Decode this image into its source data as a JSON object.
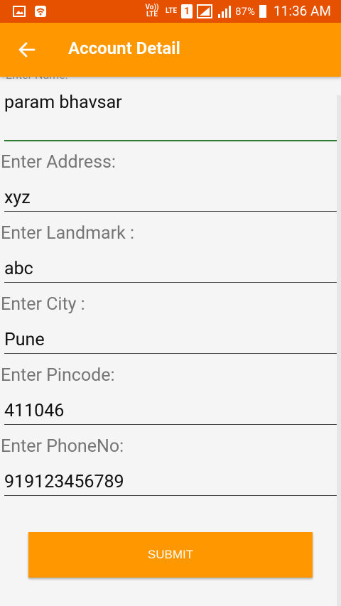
{
  "status_bar": {
    "network": "Vo)) LTE",
    "lte": "LTE",
    "sim": "1",
    "battery_percent": "87%",
    "time": "11:36 AM"
  },
  "app_bar": {
    "title": "Account Detail",
    "back_icon": "arrow-back-icon"
  },
  "form": {
    "name_label_partial": "Enter Name:",
    "name_value": "param bhavsar",
    "address_label": "Enter Address:",
    "address_value": "xyz",
    "landmark_label": "Enter Landmark :",
    "landmark_value": "abc",
    "city_label": "Enter City :",
    "city_value": "Pune",
    "pincode_label": "Enter Pincode:",
    "pincode_value": "411046",
    "phone_label": "Enter PhoneNo:",
    "phone_value": "919123456789",
    "submit_label": "SUBMIT"
  },
  "colors": {
    "app_bar": "#ff9800",
    "status_bar": "#e65100",
    "active_underline": "#2e7d32"
  }
}
